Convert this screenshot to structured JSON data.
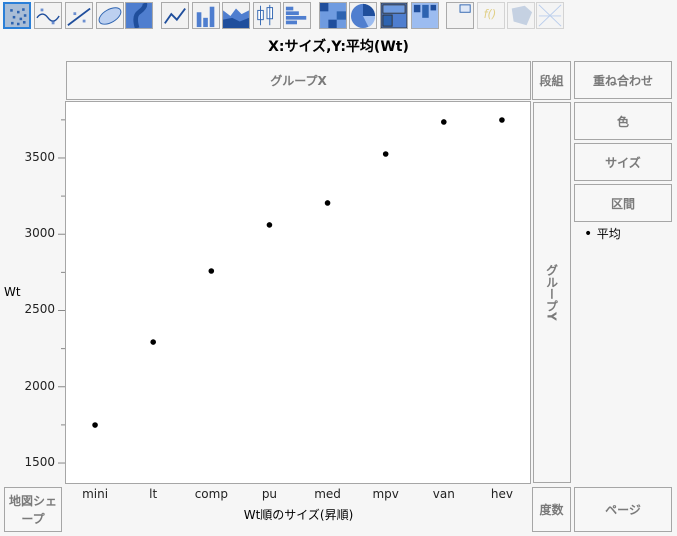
{
  "toolbar": {
    "icons": [
      "points",
      "smoother",
      "line-of-fit",
      "ellipse",
      "contour",
      "line",
      "bar",
      "area",
      "box-plot",
      "histogram",
      "heatmap",
      "pie",
      "treemap",
      "mosaic",
      "caption-box",
      "formula",
      "map-shape",
      "parallel"
    ]
  },
  "title": "X:サイズ,Y:平均(Wt)",
  "zones": {
    "group_x": "グループX",
    "wrap": "段組",
    "overlay": "重ね合わせ",
    "color": "色",
    "size": "サイズ",
    "interval": "区間",
    "group_y": "グループY",
    "map_shape": "地図シェープ",
    "freq": "度数",
    "page": "ページ"
  },
  "legend": {
    "items": [
      {
        "label": "平均",
        "color": "#000000"
      }
    ]
  },
  "chart_data": {
    "type": "scatter",
    "title": "X:サイズ,Y:平均(Wt)",
    "xlabel": "Wt順のサイズ(昇順)",
    "ylabel": "Wt",
    "categories": [
      "mini",
      "lt",
      "comp",
      "pu",
      "med",
      "mpv",
      "van",
      "hev"
    ],
    "values": [
      1749,
      2293,
      2759,
      3061,
      3205,
      3526,
      3736,
      3749
    ],
    "yticks": [
      "1500",
      "2000",
      "2500",
      "3000",
      "3500"
    ],
    "ylim": [
      1369,
      3867
    ],
    "grid": false
  }
}
